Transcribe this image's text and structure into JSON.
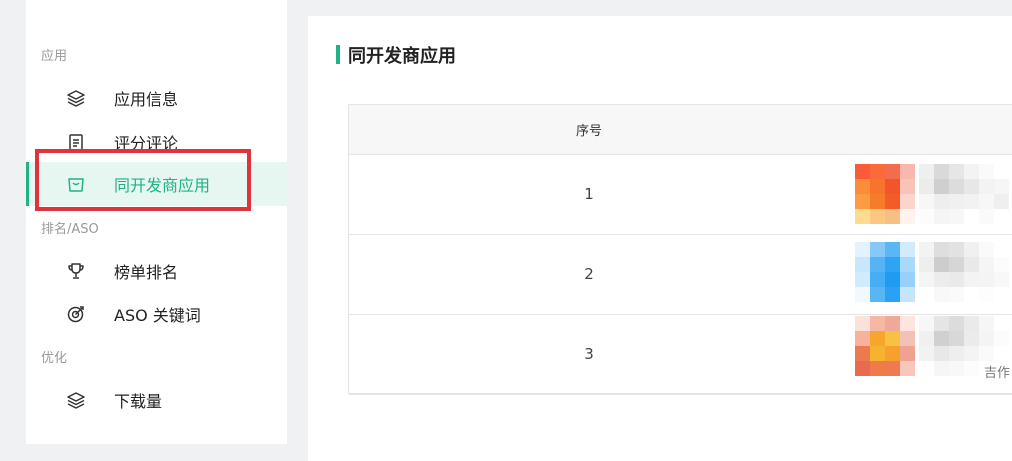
{
  "sidebar": {
    "groups": [
      {
        "title": "应用"
      },
      {
        "title": "排名/ASO"
      },
      {
        "title": "优化"
      }
    ],
    "items": [
      {
        "label": "应用信息",
        "icon": "layers-icon"
      },
      {
        "label": "评分评论",
        "icon": "clipboard-icon"
      },
      {
        "label": "同开发商应用",
        "icon": "bag-icon",
        "active": true
      },
      {
        "label": "榜单排名",
        "icon": "trophy-icon"
      },
      {
        "label": "ASO 关键词",
        "icon": "target-icon"
      },
      {
        "label": "下载量",
        "icon": "layers-icon"
      }
    ]
  },
  "main": {
    "title": "同开发商应用",
    "table": {
      "headers": [
        "序号"
      ],
      "rows": [
        {
          "index": "1"
        },
        {
          "index": "2"
        },
        {
          "index": "3",
          "partial_text": "吉作"
        }
      ]
    }
  },
  "colors": {
    "accent": "#1eb386",
    "highlight": "#e0333b",
    "logo": "#f5b82e"
  }
}
